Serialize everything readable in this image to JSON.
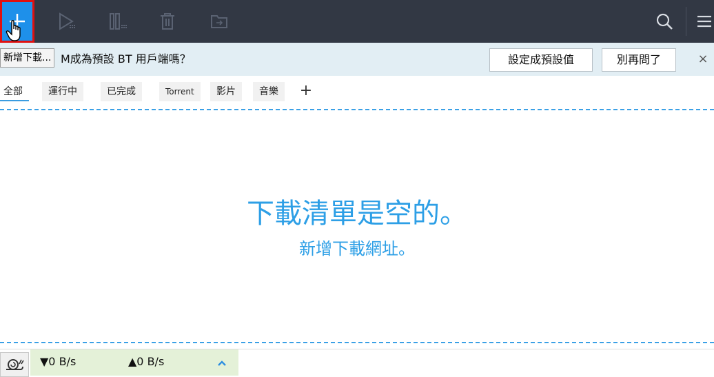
{
  "toolbar": {
    "buttons": [
      {
        "name": "add-download-button",
        "icon": "plus-icon"
      },
      {
        "name": "resume-button",
        "icon": "play-icon"
      },
      {
        "name": "pause-button",
        "icon": "pause-icon"
      },
      {
        "name": "delete-button",
        "icon": "trash-icon"
      },
      {
        "name": "move-to-folder-button",
        "icon": "folder-icon"
      },
      {
        "name": "search-button",
        "icon": "search-icon"
      },
      {
        "name": "menu-button",
        "icon": "hamburger-icon"
      }
    ],
    "tooltip": "新增下載..."
  },
  "notice": {
    "message_visible": "M成為預設 BT 用戶端嗎？",
    "set_default_label": "設定成預設值",
    "dont_ask_label": "別再問了",
    "close_label": "×"
  },
  "tabs": [
    {
      "label": "全部",
      "active": true
    },
    {
      "label": "運行中",
      "active": false
    },
    {
      "label": "已完成",
      "active": false
    },
    {
      "label": "Torrent",
      "active": false
    },
    {
      "label": "影片",
      "active": false
    },
    {
      "label": "音樂",
      "active": false
    }
  ],
  "tab_add_label": "+",
  "empty": {
    "title": "下載清單是空的。",
    "link": "新增下載網址。"
  },
  "status": {
    "download_speed": "▼0 B/s",
    "upload_speed": "▲0 B/s",
    "expand_icon": "chevron-up-icon"
  },
  "colors": {
    "toolbar_bg": "#323844",
    "accent": "#2d9fe6",
    "highlight_border": "#e01010"
  }
}
